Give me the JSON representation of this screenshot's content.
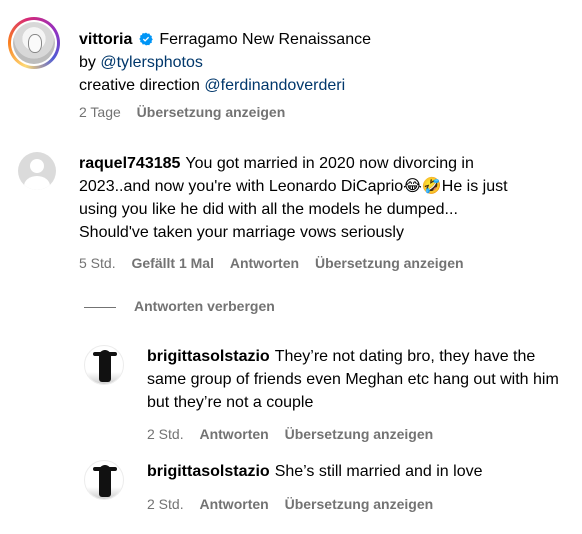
{
  "post": {
    "username": "vittoria",
    "caption_title": "Ferragamo New Renaissance",
    "by_text": "by",
    "by_handle": "@tylersphotos",
    "direction_text": "creative direction",
    "direction_handle": "@ferdinandoverderi",
    "time": "2 Tage",
    "translate": "Übersetzung anzeigen"
  },
  "comment": {
    "username": "raquel743185",
    "text": "You got married in 2020 now divorcing in 2023..and now you're with Leonardo DiCaprio😂🤣He is just using you like he did with all the models he dumped... Should've taken your marriage vows seriously",
    "time": "5 Std.",
    "likes": "Gefällt 1 Mal",
    "reply": "Antworten",
    "translate": "Übersetzung anzeigen"
  },
  "hide_replies": "Antworten verbergen",
  "replies": [
    {
      "username": "brigittasolstazio",
      "text": "They’re not dating bro, they have the same group of friends even Meghan etc hang out with him but they’re not a couple",
      "time": "2 Std.",
      "reply": "Antworten",
      "translate": "Übersetzung anzeigen"
    },
    {
      "username": "brigittasolstazio",
      "text": "She’s still married and in love",
      "time": "2 Std.",
      "reply": "Antworten",
      "translate": "Übersetzung anzeigen"
    }
  ],
  "colors": {
    "meta_gray": "#737373",
    "link_blue": "#00376b",
    "verified_blue": "#0095f6"
  },
  "icons": [
    "verified-badge-icon",
    "default-avatar-icon"
  ]
}
